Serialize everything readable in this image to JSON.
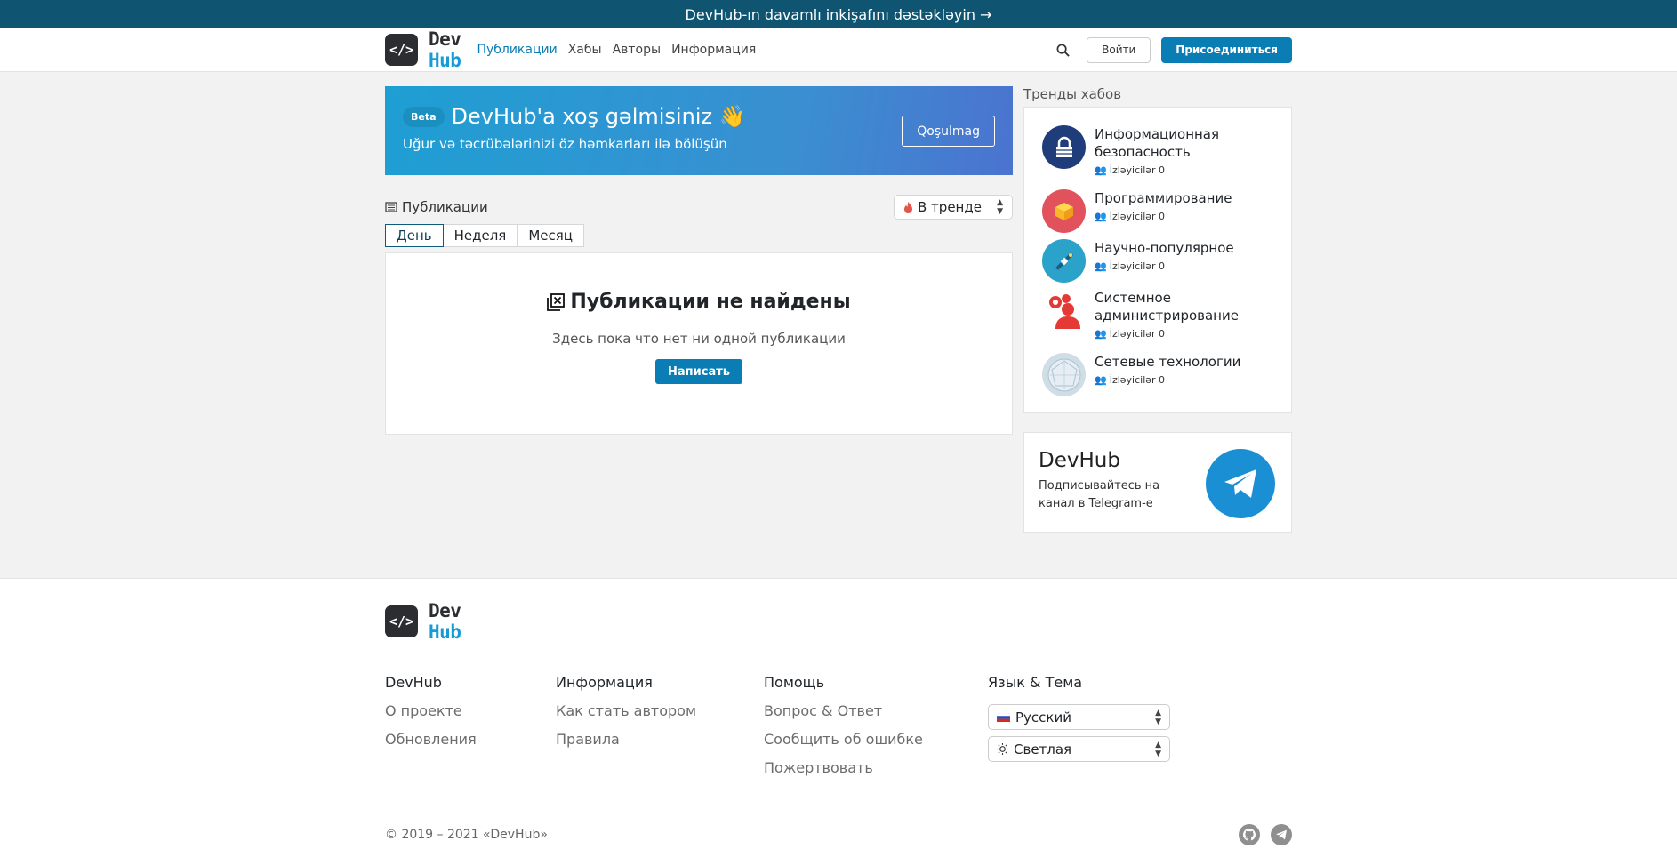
{
  "banner": {
    "text": "DevHub-ın davamlı inkişafını dəstəkləyin →"
  },
  "logo": {
    "mark": "</>",
    "dev": "Dev",
    "hub": "Hub"
  },
  "nav": {
    "items": [
      "Публикации",
      "Хабы",
      "Авторы",
      "Информация"
    ],
    "login": "Войти",
    "join": "Присоединиться"
  },
  "hero": {
    "badge": "Beta",
    "title": "DevHub'a xoş gəlmisiniz 👋",
    "subtitle": "Uğur və təcrübələrinizi öz həmkarları ilə bölüşün",
    "button": "Qoşulmag"
  },
  "posts": {
    "title": "Публикации",
    "sort": "В тренде",
    "tabs": [
      "День",
      "Неделя",
      "Месяц"
    ],
    "empty_title": "Публикации не найдены",
    "empty_text": "Здесь пока что нет ни одной публикации",
    "write": "Написать"
  },
  "hubs": {
    "title": "Тренды хабов",
    "items": [
      {
        "name": "Информационная безопасность",
        "followers": "İzləyicilər 0",
        "color": "#1e3d7a"
      },
      {
        "name": "Программирование",
        "followers": "İzləyicilər 0",
        "color": "#e2525c"
      },
      {
        "name": "Научно-популярное",
        "followers": "İzləyicilər 0",
        "color": "#2aa2c9"
      },
      {
        "name": "Системное администрирование",
        "followers": "İzləyicilər 0",
        "color": "#e53935"
      },
      {
        "name": "Сетевые технологии",
        "followers": "İzləyicilər 0",
        "color": "#cfdde6"
      }
    ]
  },
  "telegram": {
    "title": "DevHub",
    "text": "Подписывайтесь на канал в Telegram-е"
  },
  "footer": {
    "cols": [
      {
        "title": "DevHub",
        "links": [
          "О проекте",
          "Обновления"
        ]
      },
      {
        "title": "Информация",
        "links": [
          "Как стать автором",
          "Правила"
        ]
      },
      {
        "title": "Помощь",
        "links": [
          "Вопрос & Ответ",
          "Сообщить об ошибке",
          "Пожертвовать"
        ]
      }
    ],
    "lang_title": "Язык & Тема",
    "language": "Русский",
    "theme": "Светлая",
    "copyright": "© 2019 – 2021 «DevHub»"
  }
}
